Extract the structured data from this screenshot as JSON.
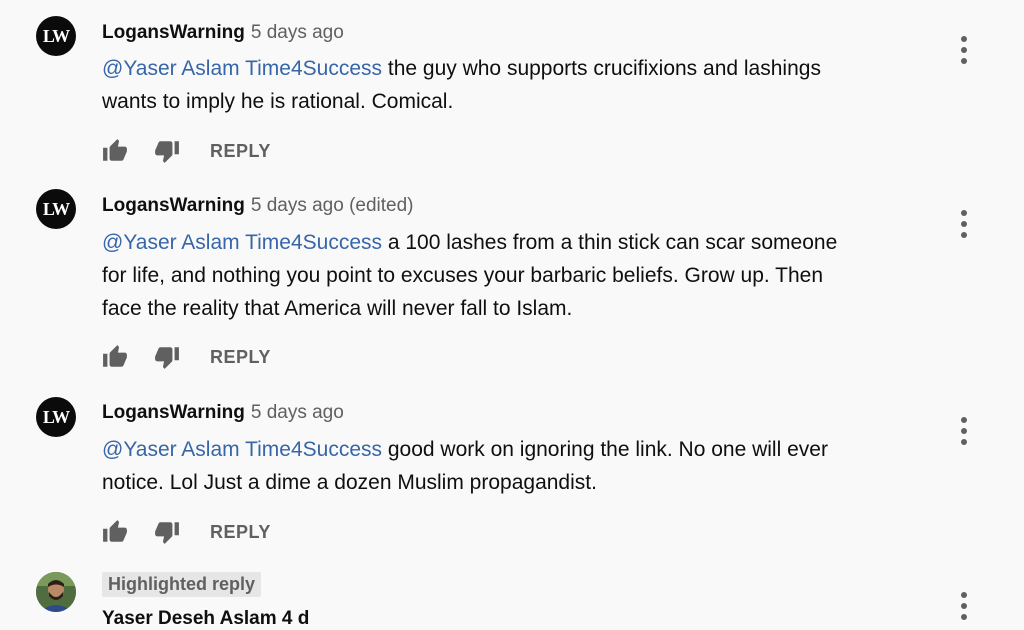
{
  "comments": [
    {
      "author": "LogansWarning",
      "avatar_text": "LW",
      "meta": "5 days ago",
      "mention": "@Yaser Aslam Time4Success",
      "text_line1": " the guy who supports crucifixions and lashings",
      "text_line2": "wants to imply he is rational. Comical.",
      "text_line3": "",
      "reply_label": "REPLY"
    },
    {
      "author": "LogansWarning",
      "avatar_text": "LW",
      "meta": "5 days ago (edited)",
      "mention": "@Yaser Aslam Time4Success",
      "text_line1": " a 100 lashes from a thin stick can scar someone",
      "text_line2": "for life, and nothing you point to excuses your barbaric beliefs. Grow up. Then",
      "text_line3": "face the reality that America will never fall to Islam.",
      "reply_label": "REPLY"
    },
    {
      "author": "LogansWarning",
      "avatar_text": "LW",
      "meta": "5 days ago",
      "mention": "@Yaser Aslam Time4Success",
      "text_line1": " good work on ignoring the link. No one will ever",
      "text_line2": "notice. Lol Just a dime a dozen Muslim propagandist.",
      "text_line3": "",
      "reply_label": "REPLY"
    }
  ],
  "highlighted": {
    "badge": "Highlighted reply",
    "author_partial": "Yaser Deseh Aslam  4 d"
  },
  "colors": {
    "background": "#f9f9f9",
    "mention": "#3766a8",
    "secondary_text": "#606060"
  },
  "icons": {
    "like": "thumb-up-icon",
    "dislike": "thumb-down-icon",
    "menu": "more-vert-icon"
  }
}
